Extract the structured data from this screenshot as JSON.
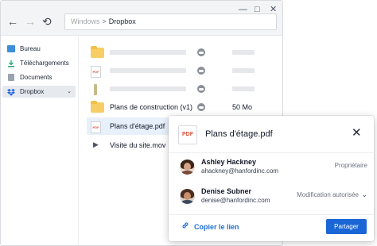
{
  "window": {
    "controls": {
      "minimize": "—",
      "maximize": "□",
      "close": "✕"
    },
    "nav": {
      "back": "←",
      "forward": "→",
      "refresh": "⟲"
    },
    "address": {
      "root": "Windows",
      "separator": ">",
      "current": "Dropbox"
    }
  },
  "sidebar": {
    "items": [
      {
        "label": "Bureau",
        "icon": "desktop-icon"
      },
      {
        "label": "Téléchargements",
        "icon": "download-icon"
      },
      {
        "label": "Documents",
        "icon": "document-icon"
      },
      {
        "label": "Dropbox",
        "icon": "dropbox-icon",
        "chevron": "⌄"
      }
    ]
  },
  "files": [
    {
      "icon": "folder-icon",
      "name": "",
      "size": ""
    },
    {
      "icon": "pdf-icon",
      "name": "",
      "size": ""
    },
    {
      "icon": "file-icon",
      "name": "",
      "size": ""
    },
    {
      "icon": "folder-icon",
      "name": "Plans de construction (v1)",
      "size": "50 Mo"
    },
    {
      "icon": "pdf-icon",
      "name": "Plans d'étage.pdf",
      "size": ""
    },
    {
      "icon": "video-icon",
      "name": "Visite du site.mov",
      "size": ""
    }
  ],
  "file_icon_labels": {
    "pdf": "PDF"
  },
  "share_dialog": {
    "file_icon_label": "PDF",
    "title": "Plans d'étage.pdf",
    "close": "✕",
    "people": [
      {
        "name": "Ashley Hackney",
        "email": "ahackney@hanfordinc.com",
        "role": "Propriétaire"
      },
      {
        "name": "Denise Subner",
        "email": "denise@hanfordinc.com",
        "role": "Modification autorisée",
        "caret": "⌄"
      }
    ],
    "copy_link": "Copier le lien",
    "link_icon": "🔗",
    "share_button": "Partager"
  },
  "colors": {
    "accent": "#1a66d6",
    "folder": "#f7cd65",
    "selected_row": "#e8f0fb"
  }
}
